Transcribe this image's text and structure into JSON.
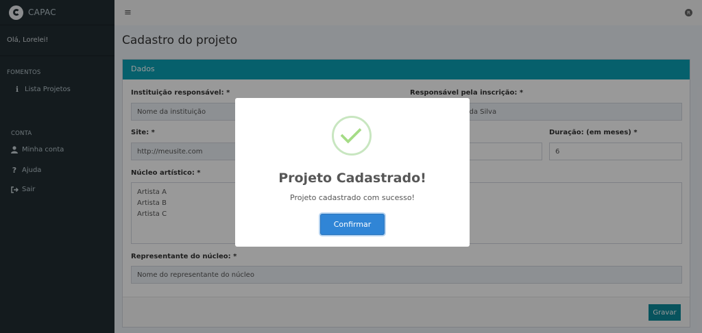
{
  "app": {
    "name": "CAPAC"
  },
  "sidebar": {
    "greeting": "Olá, Lorelei!",
    "sections": [
      {
        "title": "FOMENTOS",
        "items": [
          {
            "label": "Lista Projetos",
            "icon": "info-icon"
          }
        ]
      },
      {
        "title": "CONTA",
        "items": [
          {
            "label": "Minha conta",
            "icon": "user-icon"
          },
          {
            "label": "Ajuda",
            "icon": "question-icon"
          },
          {
            "label": "Sair",
            "icon": "sign-out-icon"
          }
        ]
      }
    ]
  },
  "page": {
    "title": "Cadastro do projeto"
  },
  "form": {
    "header": "Dados",
    "instituicao_label": "Instituição responsável: *",
    "instituicao_value": "Nome da instituição",
    "responsavel_label": "Responsável pela inscrição: *",
    "responsavel_value": "astro Lourenço da Silva",
    "site_label": "Site: *",
    "site_value": "http://meusite.com",
    "duracao_label": "Duração: (em meses) *",
    "duracao_value": "6",
    "nucleo_label": "Núcleo artístico: *",
    "nucleo_lines": [
      "Artista A",
      "Artista B",
      "Artista C"
    ],
    "representante_label": "Representante do núcleo: *",
    "representante_value": "Nome do representante do núcleo",
    "gravar_label": "Gravar"
  },
  "modal": {
    "title": "Projeto Cadastrado!",
    "text": "Projeto cadastrado com sucesso!",
    "confirm_label": "Confirmar"
  },
  "colors": {
    "header": "#0aa1b4",
    "sidebar": "#222d32",
    "confirm": "#3085d6",
    "success": "#a5dc86"
  }
}
